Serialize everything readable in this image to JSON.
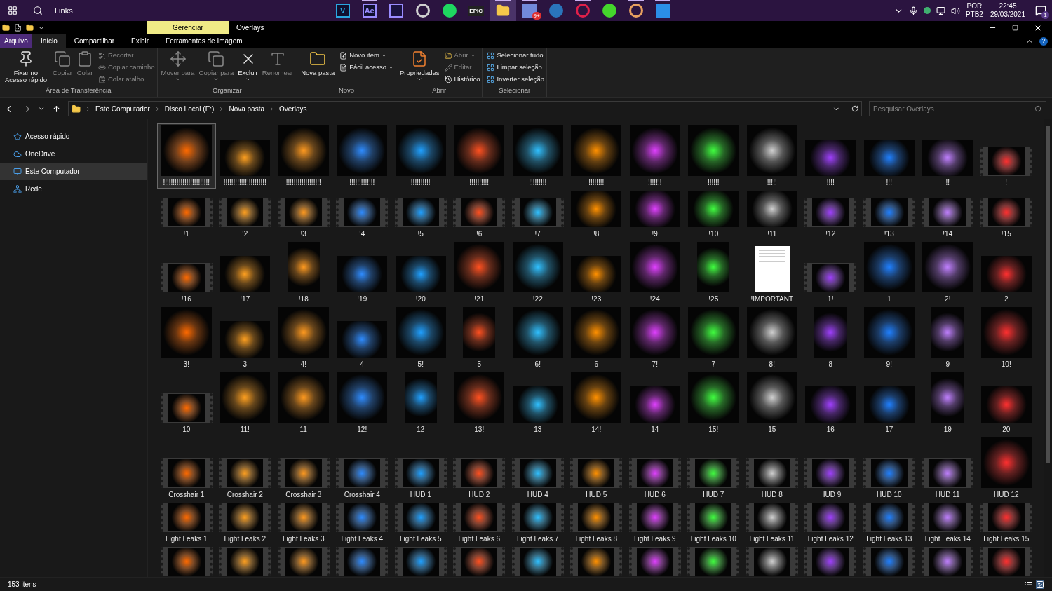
{
  "taskbar": {
    "search_label": "Links",
    "apps": [
      {
        "kind": "tile",
        "glyph": "V",
        "color": "#2aa7e0",
        "running": false,
        "selected": false
      },
      {
        "kind": "tile",
        "glyph": "Ae",
        "color": "#9a8cff",
        "running": true,
        "selected": false
      },
      {
        "kind": "chart",
        "color": "#9a8cff",
        "running": false,
        "selected": false
      },
      {
        "kind": "ring",
        "color": "#cfcfcf",
        "running": false,
        "selected": false
      },
      {
        "kind": "disc",
        "color": "#1ed760",
        "running": false,
        "selected": false
      },
      {
        "kind": "label",
        "glyph": "EPIC",
        "running": false,
        "selected": false
      },
      {
        "kind": "folder",
        "color": "#f6c94a",
        "running": true,
        "selected": true
      },
      {
        "kind": "tile",
        "color": "#7289da",
        "badge": "9+",
        "running": true,
        "selected": false
      },
      {
        "kind": "disc",
        "color": "#2a75bb",
        "running": false,
        "selected": false
      },
      {
        "kind": "ring",
        "color": "#e0204a",
        "running": true,
        "selected": false
      },
      {
        "kind": "disc",
        "color": "#44d62c",
        "running": false,
        "selected": false
      },
      {
        "kind": "ring",
        "color": "#e8a060",
        "running": true,
        "selected": false
      },
      {
        "kind": "tile",
        "color": "#2b8fe8",
        "running": true,
        "selected": false
      }
    ],
    "language": "POR",
    "layout": "PTB2",
    "time": "22:45",
    "date": "29/03/2021",
    "notification_count": "1"
  },
  "window": {
    "context_tab": "Gerenciar",
    "title": "Overlays",
    "help": "?"
  },
  "ribbon_tabs": [
    {
      "label": "Arquivo",
      "kind": "file",
      "selected": false
    },
    {
      "label": "Início",
      "kind": "tab",
      "selected": true
    },
    {
      "label": "Compartilhar",
      "kind": "tab",
      "selected": false
    },
    {
      "label": "Exibir",
      "kind": "tab",
      "selected": false
    },
    {
      "label": "Ferramentas de Imagem",
      "kind": "tab",
      "selected": false
    }
  ],
  "ribbon_groups": [
    {
      "title": "Área de Transferência",
      "commands": [
        {
          "label": "Fixar no Acesso rápido",
          "kind": "large",
          "disabled": false
        },
        {
          "label": "Copiar",
          "kind": "large",
          "disabled": true
        },
        {
          "label": "Colar",
          "kind": "large",
          "disabled": true
        },
        {
          "label": "Recortar",
          "kind": "small",
          "disabled": true
        },
        {
          "label": "Copiar caminho",
          "kind": "small",
          "disabled": true
        },
        {
          "label": "Colar atalho",
          "kind": "small",
          "disabled": true
        }
      ]
    },
    {
      "title": "Organizar",
      "commands": [
        {
          "label": "Mover para",
          "kind": "large",
          "disabled": true,
          "menu": true
        },
        {
          "label": "Copiar para",
          "kind": "large",
          "disabled": true,
          "menu": true
        },
        {
          "label": "Excluir",
          "kind": "large",
          "disabled": false,
          "menu": true
        },
        {
          "label": "Renomear",
          "kind": "large",
          "disabled": true
        }
      ]
    },
    {
      "title": "Novo",
      "commands": [
        {
          "label": "Nova pasta",
          "kind": "large",
          "disabled": false
        },
        {
          "label": "Novo item",
          "kind": "small",
          "disabled": false,
          "menu": true
        },
        {
          "label": "Fácil acesso",
          "kind": "small",
          "disabled": false,
          "menu": true
        }
      ]
    },
    {
      "title": "Abrir",
      "commands": [
        {
          "label": "Propriedades",
          "kind": "large",
          "disabled": false,
          "menu": true
        },
        {
          "label": "Abrir",
          "kind": "small",
          "disabled": true,
          "menu": true
        },
        {
          "label": "Editar",
          "kind": "small",
          "disabled": true
        },
        {
          "label": "Histórico",
          "kind": "small",
          "disabled": false
        }
      ]
    },
    {
      "title": "Selecionar",
      "commands": [
        {
          "label": "Selecionar tudo",
          "kind": "small",
          "disabled": false
        },
        {
          "label": "Limpar seleção",
          "kind": "small",
          "disabled": false
        },
        {
          "label": "Inverter seleção",
          "kind": "small",
          "disabled": false
        }
      ]
    }
  ],
  "address": {
    "crumbs": [
      "Este Computador",
      "Disco Local (E:)",
      "Nova pasta",
      "Overlays"
    ],
    "search_placeholder": "Pesquisar Overlays"
  },
  "sidebar": {
    "items": [
      {
        "label": "Acesso rápido",
        "selected": false
      },
      {
        "label": "OneDrive",
        "selected": false
      },
      {
        "label": "Este Computador",
        "selected": true
      },
      {
        "label": "Rede",
        "selected": false
      }
    ]
  },
  "rows": [
    [
      {
        "label": "!!!!!!!!!!!!!!!!!!!!!!!!",
        "kind": "square",
        "selected": true
      },
      {
        "label": "!!!!!!!!!!!!!!!!!!!!!!",
        "kind": "wide",
        "selected": false
      },
      {
        "label": "!!!!!!!!!!!!!!!!!!",
        "kind": "square",
        "selected": false
      },
      {
        "label": "!!!!!!!!!!!!!",
        "kind": "square",
        "selected": false
      },
      {
        "label": "!!!!!!!!!!",
        "kind": "square",
        "selected": false
      },
      {
        "label": "!!!!!!!!!!",
        "kind": "square",
        "selected": false
      },
      {
        "label": "!!!!!!!!!",
        "kind": "square",
        "selected": false
      },
      {
        "label": "!!!!!!!!",
        "kind": "square",
        "selected": false
      },
      {
        "label": "!!!!!!!",
        "kind": "square",
        "selected": false
      },
      {
        "label": "!!!!!!",
        "kind": "square",
        "selected": false
      },
      {
        "label": "!!!!!",
        "kind": "square",
        "selected": false
      },
      {
        "label": "!!!!",
        "kind": "wide",
        "selected": false
      },
      {
        "label": "!!!",
        "kind": "wide",
        "selected": false
      },
      {
        "label": "!!",
        "kind": "wide",
        "selected": false
      },
      {
        "label": "!",
        "kind": "video",
        "selected": false
      }
    ],
    [
      {
        "label": "!1",
        "kind": "video",
        "selected": false
      },
      {
        "label": "!2",
        "kind": "video",
        "selected": false
      },
      {
        "label": "!3",
        "kind": "video",
        "selected": false
      },
      {
        "label": "!4",
        "kind": "video",
        "selected": false
      },
      {
        "label": "!5",
        "kind": "video",
        "selected": false
      },
      {
        "label": "!6",
        "kind": "video",
        "selected": false
      },
      {
        "label": "!7",
        "kind": "video",
        "selected": false
      },
      {
        "label": "!8",
        "kind": "wide",
        "selected": false
      },
      {
        "label": "!9",
        "kind": "wide",
        "selected": false
      },
      {
        "label": "!10",
        "kind": "wide",
        "selected": false
      },
      {
        "label": "!11",
        "kind": "wide",
        "selected": false
      },
      {
        "label": "!12",
        "kind": "video",
        "selected": false
      },
      {
        "label": "!13",
        "kind": "video",
        "selected": false
      },
      {
        "label": "!14",
        "kind": "video",
        "selected": false
      },
      {
        "label": "!15",
        "kind": "video",
        "selected": false
      }
    ],
    [
      {
        "label": "!16",
        "kind": "video",
        "selected": false
      },
      {
        "label": "!17",
        "kind": "wide",
        "selected": false
      },
      {
        "label": "!18",
        "kind": "tall",
        "selected": false
      },
      {
        "label": "!19",
        "kind": "wide",
        "selected": false
      },
      {
        "label": "!20",
        "kind": "wide",
        "selected": false
      },
      {
        "label": "!21",
        "kind": "square",
        "selected": false
      },
      {
        "label": "!22",
        "kind": "square",
        "selected": false
      },
      {
        "label": "!23",
        "kind": "wide",
        "selected": false
      },
      {
        "label": "!24",
        "kind": "square",
        "selected": false
      },
      {
        "label": "!25",
        "kind": "tall",
        "selected": false
      },
      {
        "label": "!IMPORTANT",
        "kind": "document",
        "selected": false
      },
      {
        "label": "1!",
        "kind": "video",
        "selected": false
      },
      {
        "label": "1",
        "kind": "square",
        "selected": false
      },
      {
        "label": "2!",
        "kind": "square",
        "selected": false
      },
      {
        "label": "2",
        "kind": "wide",
        "selected": false
      }
    ],
    [
      {
        "label": "3!",
        "kind": "square",
        "selected": false
      },
      {
        "label": "3",
        "kind": "wide",
        "selected": false
      },
      {
        "label": "4!",
        "kind": "square",
        "selected": false
      },
      {
        "label": "4",
        "kind": "wide",
        "selected": false
      },
      {
        "label": "5!",
        "kind": "square",
        "selected": false
      },
      {
        "label": "5",
        "kind": "tall",
        "selected": false
      },
      {
        "label": "6!",
        "kind": "square",
        "selected": false
      },
      {
        "label": "6",
        "kind": "square",
        "selected": false
      },
      {
        "label": "7!",
        "kind": "square",
        "selected": false
      },
      {
        "label": "7",
        "kind": "square",
        "selected": false
      },
      {
        "label": "8!",
        "kind": "square",
        "selected": false
      },
      {
        "label": "8",
        "kind": "tall",
        "selected": false
      },
      {
        "label": "9!",
        "kind": "square",
        "selected": false
      },
      {
        "label": "9",
        "kind": "tall",
        "selected": false
      },
      {
        "label": "10!",
        "kind": "square",
        "selected": false
      }
    ],
    [
      {
        "label": "10",
        "kind": "video",
        "selected": false
      },
      {
        "label": "11!",
        "kind": "square",
        "selected": false
      },
      {
        "label": "11",
        "kind": "square",
        "selected": false
      },
      {
        "label": "12!",
        "kind": "square",
        "selected": false
      },
      {
        "label": "12",
        "kind": "tall",
        "selected": false
      },
      {
        "label": "13!",
        "kind": "square",
        "selected": false
      },
      {
        "label": "13",
        "kind": "wide",
        "selected": false
      },
      {
        "label": "14!",
        "kind": "square",
        "selected": false
      },
      {
        "label": "14",
        "kind": "wide",
        "selected": false
      },
      {
        "label": "15!",
        "kind": "square",
        "selected": false
      },
      {
        "label": "15",
        "kind": "square",
        "selected": false
      },
      {
        "label": "16",
        "kind": "wide",
        "selected": false
      },
      {
        "label": "17",
        "kind": "wide",
        "selected": false
      },
      {
        "label": "19",
        "kind": "tall",
        "selected": false
      },
      {
        "label": "20",
        "kind": "wide",
        "selected": false
      }
    ],
    [
      {
        "label": "Crosshair 1",
        "kind": "video",
        "selected": false
      },
      {
        "label": "Crosshair 2",
        "kind": "video",
        "selected": false
      },
      {
        "label": "Crosshair 3",
        "kind": "video",
        "selected": false
      },
      {
        "label": "Crosshair 4",
        "kind": "video",
        "selected": false
      },
      {
        "label": "HUD 1",
        "kind": "video",
        "selected": false
      },
      {
        "label": "HUD 2",
        "kind": "video",
        "selected": false
      },
      {
        "label": "HUD 4",
        "kind": "video",
        "selected": false
      },
      {
        "label": "HUD 5",
        "kind": "video",
        "selected": false
      },
      {
        "label": "HUD 6",
        "kind": "video",
        "selected": false
      },
      {
        "label": "HUD 7",
        "kind": "video",
        "selected": false
      },
      {
        "label": "HUD 8",
        "kind": "video",
        "selected": false
      },
      {
        "label": "HUD 9",
        "kind": "video",
        "selected": false
      },
      {
        "label": "HUD 10",
        "kind": "video",
        "selected": false
      },
      {
        "label": "HUD 11",
        "kind": "video",
        "selected": false
      },
      {
        "label": "HUD 12",
        "kind": "square",
        "selected": false
      }
    ],
    [
      {
        "label": "Light Leaks 1",
        "kind": "video",
        "selected": false
      },
      {
        "label": "Light Leaks 2",
        "kind": "video",
        "selected": false
      },
      {
        "label": "Light Leaks 3",
        "kind": "video",
        "selected": false
      },
      {
        "label": "Light Leaks 4",
        "kind": "video",
        "selected": false
      },
      {
        "label": "Light Leaks 5",
        "kind": "video",
        "selected": false
      },
      {
        "label": "Light Leaks 6",
        "kind": "video",
        "selected": false
      },
      {
        "label": "Light Leaks 7",
        "kind": "video",
        "selected": false
      },
      {
        "label": "Light Leaks 8",
        "kind": "video",
        "selected": false
      },
      {
        "label": "Light Leaks 9",
        "kind": "video",
        "selected": false
      },
      {
        "label": "Light Leaks 10",
        "kind": "video",
        "selected": false
      },
      {
        "label": "Light Leaks 11",
        "kind": "video",
        "selected": false
      },
      {
        "label": "Light Leaks 12",
        "kind": "video",
        "selected": false
      },
      {
        "label": "Light Leaks 13",
        "kind": "video",
        "selected": false
      },
      {
        "label": "Light Leaks 14",
        "kind": "video",
        "selected": false
      },
      {
        "label": "Light Leaks 15",
        "kind": "video",
        "selected": false
      }
    ],
    [
      {
        "kind": "video",
        "selected": false
      },
      {
        "kind": "video",
        "selected": false
      },
      {
        "kind": "video",
        "selected": false
      },
      {
        "kind": "video",
        "selected": false
      },
      {
        "kind": "video",
        "selected": false
      },
      {
        "kind": "video",
        "selected": false
      },
      {
        "kind": "video",
        "selected": false
      },
      {
        "kind": "video",
        "selected": false
      },
      {
        "kind": "video",
        "selected": false
      },
      {
        "kind": "video",
        "selected": false
      },
      {
        "kind": "video",
        "selected": false
      },
      {
        "kind": "video",
        "selected": false
      },
      {
        "kind": "video",
        "selected": false
      },
      {
        "kind": "video",
        "selected": false
      },
      {
        "kind": "video",
        "selected": false
      }
    ]
  ],
  "status": {
    "count": "153 itens"
  }
}
